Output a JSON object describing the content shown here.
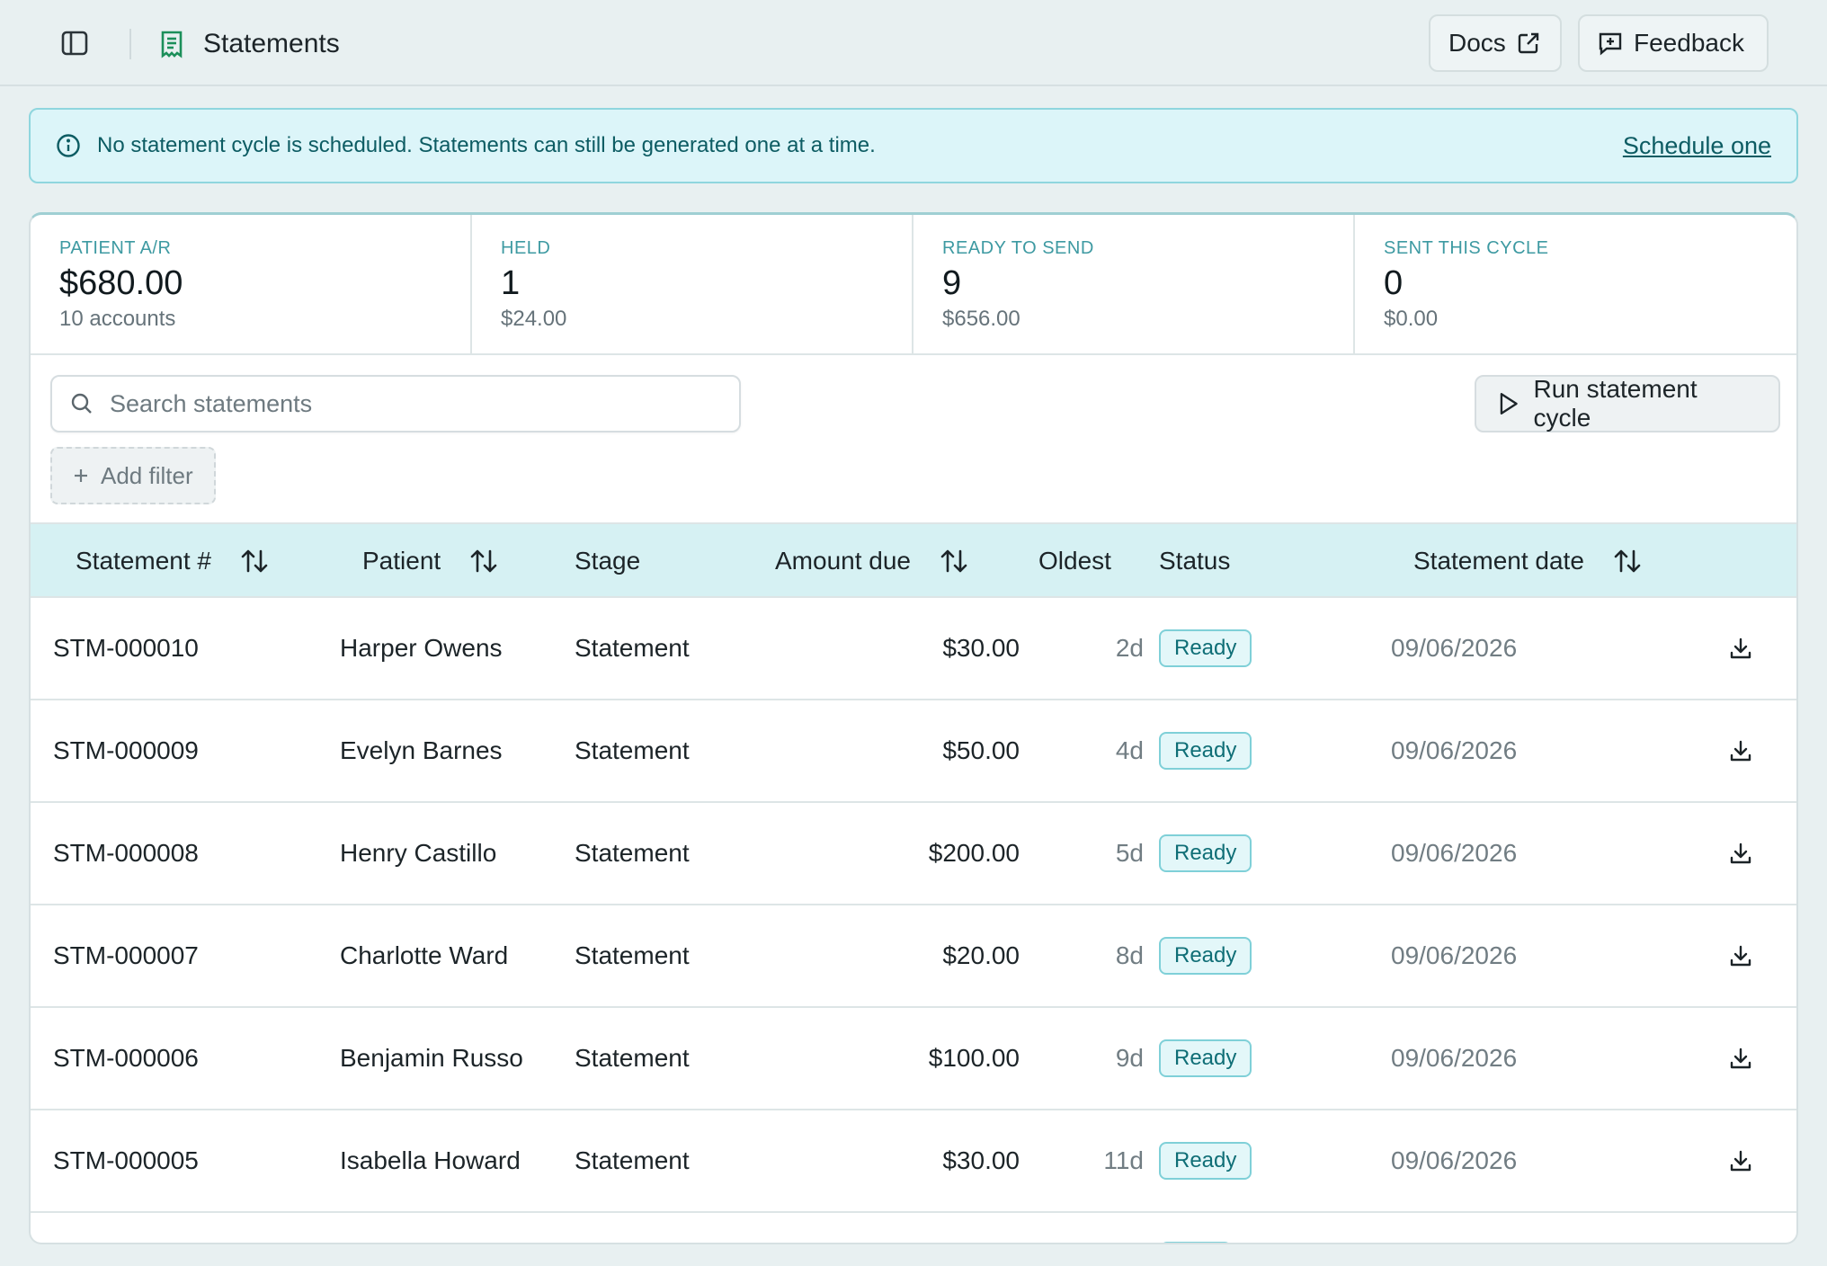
{
  "header": {
    "title": "Statements",
    "docs_label": "Docs",
    "feedback_label": "Feedback"
  },
  "banner": {
    "message": "No statement cycle is scheduled. Statements can still be generated one at a time.",
    "link": "Schedule one"
  },
  "stats": [
    {
      "label": "PATIENT A/R",
      "value": "$680.00",
      "sub": "10 accounts"
    },
    {
      "label": "HELD",
      "value": "1",
      "sub": "$24.00"
    },
    {
      "label": "READY TO SEND",
      "value": "9",
      "sub": "$656.00"
    },
    {
      "label": "SENT THIS CYCLE",
      "value": "0",
      "sub": "$0.00"
    }
  ],
  "search": {
    "placeholder": "Search statements"
  },
  "run_cycle_label": "Run statement cycle",
  "add_filter_label": "Add filter",
  "table": {
    "columns": {
      "statement": "Statement #",
      "patient": "Patient",
      "stage": "Stage",
      "amount": "Amount due",
      "oldest": "Oldest",
      "status": "Status",
      "date": "Statement date"
    },
    "rows": [
      {
        "id": "STM-000010",
        "patient": "Harper Owens",
        "stage": "Statement",
        "amount": "$30.00",
        "oldest": "2d",
        "status": "Ready",
        "date": "09/06/2026"
      },
      {
        "id": "STM-000009",
        "patient": "Evelyn Barnes",
        "stage": "Statement",
        "amount": "$50.00",
        "oldest": "4d",
        "status": "Ready",
        "date": "09/06/2026"
      },
      {
        "id": "STM-000008",
        "patient": "Henry Castillo",
        "stage": "Statement",
        "amount": "$200.00",
        "oldest": "5d",
        "status": "Ready",
        "date": "09/06/2026"
      },
      {
        "id": "STM-000007",
        "patient": "Charlotte Ward",
        "stage": "Statement",
        "amount": "$20.00",
        "oldest": "8d",
        "status": "Ready",
        "date": "09/06/2026"
      },
      {
        "id": "STM-000006",
        "patient": "Benjamin Russo",
        "stage": "Statement",
        "amount": "$100.00",
        "oldest": "9d",
        "status": "Ready",
        "date": "09/06/2026"
      },
      {
        "id": "STM-000005",
        "patient": "Isabella Howard",
        "stage": "Statement",
        "amount": "$30.00",
        "oldest": "11d",
        "status": "Ready",
        "date": "09/06/2026"
      }
    ]
  },
  "icons": {
    "sidebar": "sidebar-toggle-icon",
    "page": "receipt-icon",
    "docs": "external-link-icon",
    "feedback": "message-plus-icon",
    "info": "info-icon",
    "search": "search-icon",
    "run": "play-icon",
    "add": "plus-icon",
    "sort": "sort-icon",
    "download": "download-icon"
  },
  "colors": {
    "accent": "#1e9aa3",
    "banner_bg": "#dcf5f9",
    "header_bg": "#d6f1f3",
    "badge_border": "#7fd0d8"
  }
}
